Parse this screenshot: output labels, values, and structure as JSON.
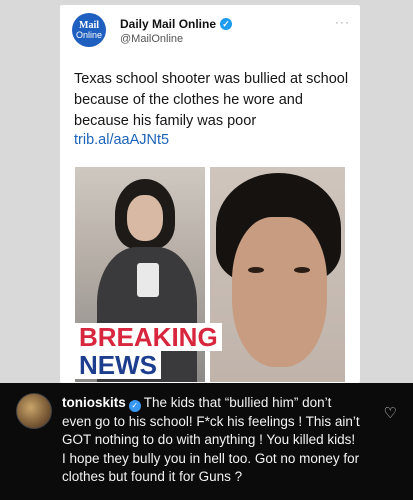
{
  "tweet": {
    "logo_line1": "Mail",
    "logo_line2": "Online",
    "account_name": "Daily Mail Online",
    "handle": "@MailOnline",
    "more": "···",
    "text": "Texas school shooter was bullied at school because of the clothes he wore and because his family was poor",
    "link": "trib.al/aaAJNt5",
    "banner_line1": "BREAKING",
    "banner_line2": "NEWS"
  },
  "comment": {
    "username": "tonioskits",
    "text": "The kids that “bullied him” don’t even go to his school! F*ck his feelings ! This ain’t GOT nothing to do with anything ! You killed kids! I hope they bully you in hell too. Got no money for clothes but found it for Guns ?",
    "like_icon": "heart-outline-icon"
  },
  "colors": {
    "verified": "#1d9bf0",
    "breaking": "#d7263d",
    "news": "#1d3e8f",
    "link": "#1d64b8"
  }
}
